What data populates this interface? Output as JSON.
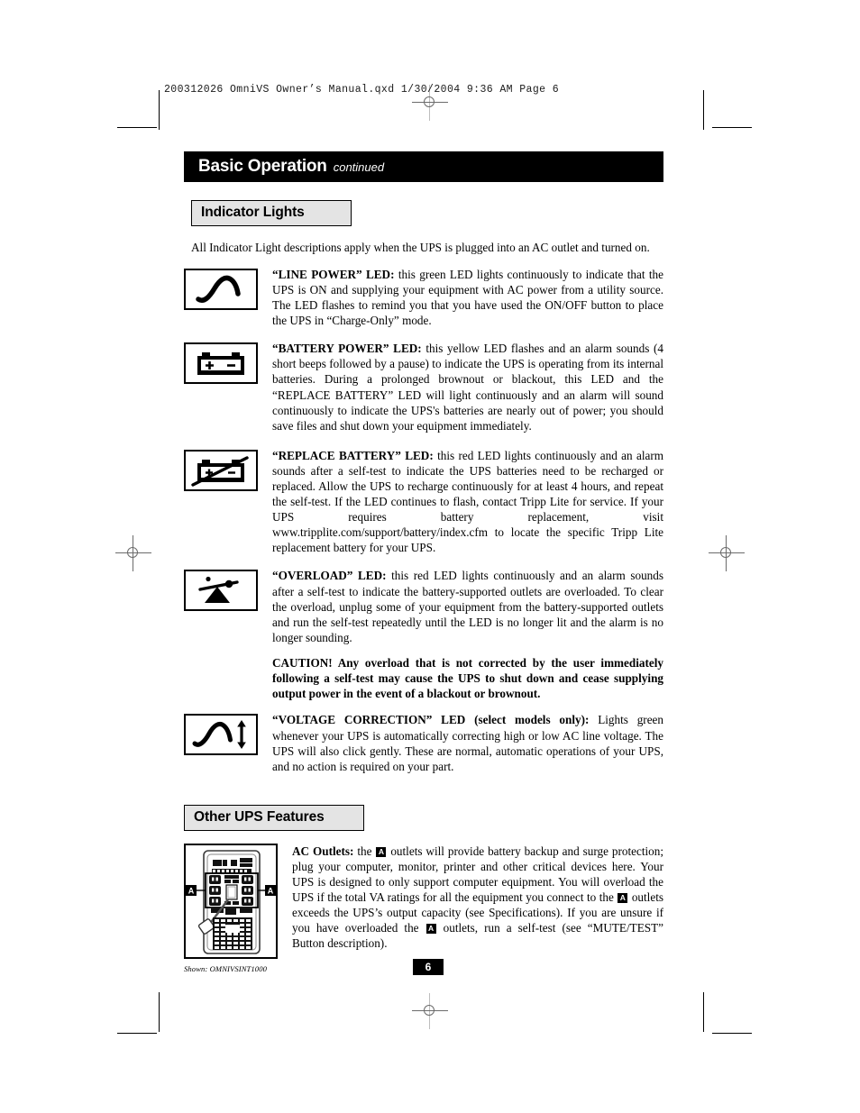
{
  "slug": {
    "text": "200312026 OmniVS Owner’s Manual.qxd   1/30/2004   9:36 AM   Page 6"
  },
  "banner": {
    "title": "Basic Operation",
    "subtitle": "continued"
  },
  "sections": {
    "indicator_lights": {
      "heading": "Indicator Lights",
      "intro": "All Indicator Light descriptions apply when the UPS is plugged into an AC outlet and turned on.",
      "items": [
        {
          "icon": "sine-wave-icon",
          "label": "“LINE POWER” LED:",
          "body": " this green LED lights continuously to indicate that the UPS is ON and supplying your equipment with AC power from a utility source. The LED flashes to remind you that you have used the ON/OFF button to place the UPS in “Charge-Only” mode."
        },
        {
          "icon": "battery-icon",
          "label": "“BATTERY POWER” LED:",
          "body": " this yellow LED flashes and an alarm sounds (4 short beeps followed by a pause) to indicate the UPS is operating from its internal batteries. During a prolonged brownout or blackout, this LED and the “REPLACE BATTERY” LED will light continuously and an alarm will sound continuously to indicate the UPS's batteries are nearly out of power; you should save files and shut down your equipment immediately."
        },
        {
          "icon": "battery-slash-icon",
          "label": "“REPLACE BATTERY” LED:",
          "body": " this red LED lights continuously and an alarm sounds after a self-test to indicate the UPS batteries need to be recharged or replaced. Allow the UPS to recharge continuously for at least 4 hours, and repeat the self-test. If the LED continues to flash, contact Tripp Lite for service. If your UPS requires battery replacement, visit www.tripplite.com/support/battery/index.cfm to locate the specific Tripp Lite replacement battery for your UPS."
        },
        {
          "icon": "overload-seesaw-icon",
          "label": "“OVERLOAD” LED:",
          "body": " this red LED lights continuously and an alarm sounds after a self-test to indicate the battery-supported outlets are overloaded. To clear the overload, unplug some of your equipment from the battery-supported outlets and run the self-test repeatedly until the LED is no longer lit and the alarm is no longer sounding."
        }
      ],
      "caution": "CAUTION! Any overload that is not corrected by the user immediately following a self-test may cause the UPS to shut down and cease supplying output power in the event of a blackout or brownout.",
      "voltage_item": {
        "icon": "sine-wave-arrow-icon",
        "label": "“VOLTAGE CORRECTION” LED (select models only):",
        "body": " Lights green whenever your UPS is automatically correcting high or low AC line voltage. The UPS will also click gently. These are normal, automatic operations of your UPS, and no action is required on your part."
      }
    },
    "other_ups_features": {
      "heading": "Other UPS Features",
      "figure_caption": "Shown: OMNIVSINT1000",
      "figure_marker_left": "A",
      "figure_marker_right": "A",
      "ac_outlets": {
        "label": "AC Outlets:",
        "part1": " the ",
        "chip1": "A",
        "part2": " outlets will provide battery backup and surge protection; plug your computer, monitor, printer and other critical devices here. Your UPS is designed to only support computer equipment. You will overload the UPS if the total VA ratings for all the equipment you connect to the ",
        "chip2": "A",
        "part3": " outlets exceeds the UPS’s output capacity (see Specifications). If you are unsure if you have overloaded the ",
        "chip3": "A",
        "part4": " outlets, run a self-test (see “MUTE/TEST” Button description)."
      }
    }
  },
  "page_number": "6"
}
